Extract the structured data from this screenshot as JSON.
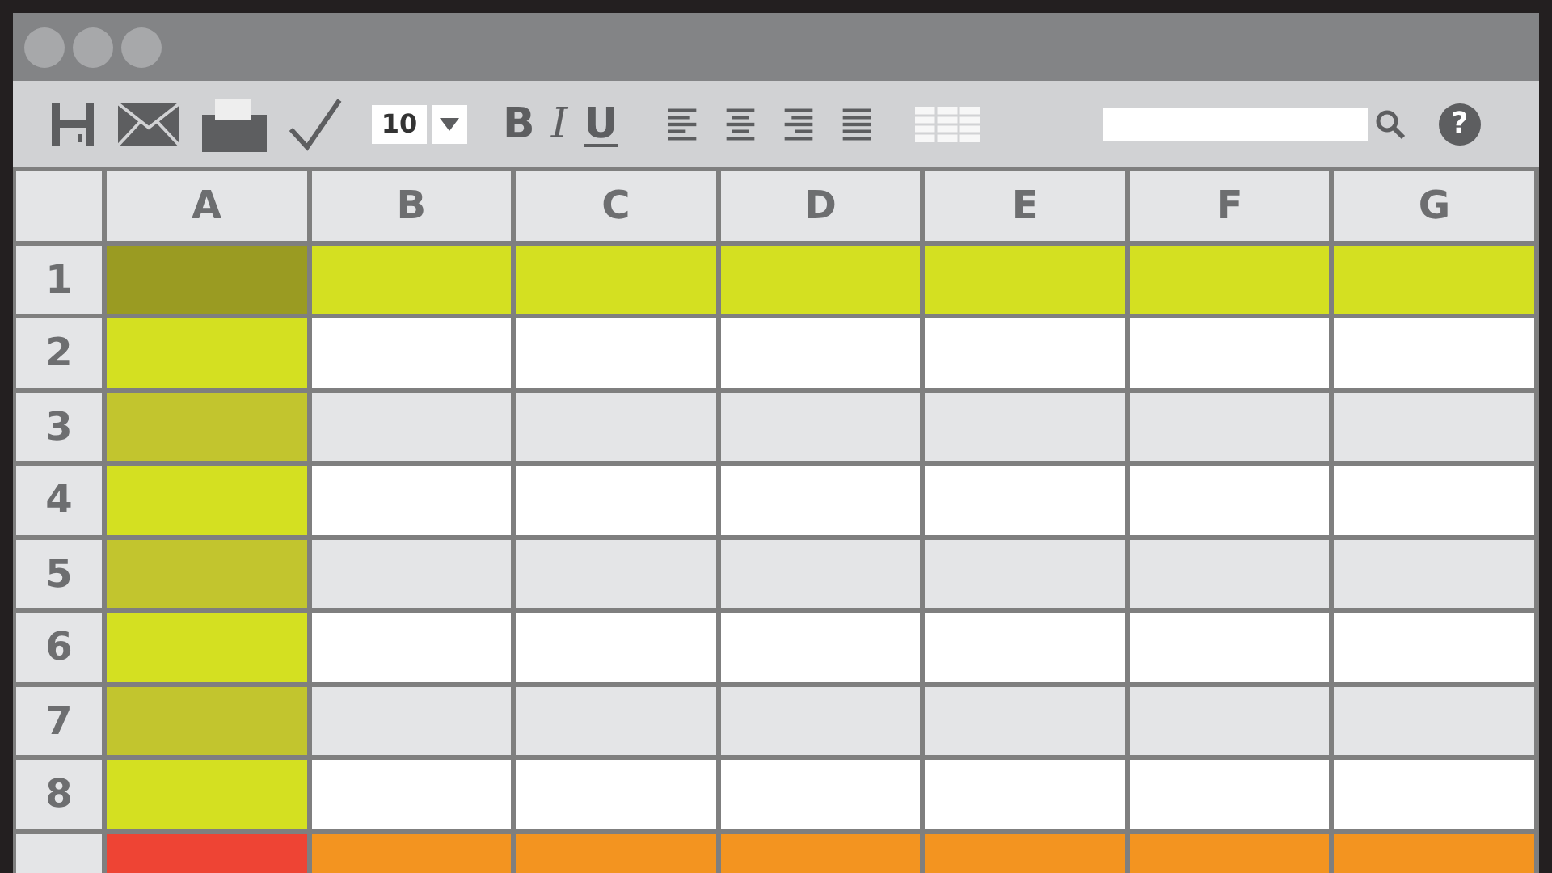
{
  "window": {
    "controls": [
      {
        "color": "#a7a8aa"
      },
      {
        "color": "#a7a8aa"
      },
      {
        "color": "#a7a8aa"
      }
    ]
  },
  "toolbar": {
    "font_size": "10",
    "format_buttons": [
      "B",
      "I",
      "U"
    ],
    "help": "?"
  },
  "sheet": {
    "columns": [
      "A",
      "B",
      "C",
      "D",
      "E",
      "F",
      "G"
    ],
    "rows": [
      {
        "label": "1",
        "cells": [
          {
            "color": "#9a9b22"
          },
          {
            "color": "#d4e021"
          },
          {
            "color": "#d4e021"
          },
          {
            "color": "#d4e021"
          },
          {
            "color": "#d4e021"
          },
          {
            "color": "#d4e021"
          },
          {
            "color": "#d4e021"
          }
        ]
      },
      {
        "label": "2",
        "cells": [
          {
            "color": "#d4e021"
          },
          {
            "color": "#ffffff"
          },
          {
            "color": "#ffffff"
          },
          {
            "color": "#ffffff"
          },
          {
            "color": "#ffffff"
          },
          {
            "color": "#ffffff"
          },
          {
            "color": "#ffffff"
          }
        ]
      },
      {
        "label": "3",
        "cells": [
          {
            "color": "#c2c52e"
          },
          {
            "color": "#e4e5e7"
          },
          {
            "color": "#e4e5e7"
          },
          {
            "color": "#e4e5e7"
          },
          {
            "color": "#e4e5e7"
          },
          {
            "color": "#e4e5e7"
          },
          {
            "color": "#e4e5e7"
          }
        ]
      },
      {
        "label": "4",
        "cells": [
          {
            "color": "#d4e021"
          },
          {
            "color": "#ffffff"
          },
          {
            "color": "#ffffff"
          },
          {
            "color": "#ffffff"
          },
          {
            "color": "#ffffff"
          },
          {
            "color": "#ffffff"
          },
          {
            "color": "#ffffff"
          }
        ]
      },
      {
        "label": "5",
        "cells": [
          {
            "color": "#c2c52e"
          },
          {
            "color": "#e4e5e7"
          },
          {
            "color": "#e4e5e7"
          },
          {
            "color": "#e4e5e7"
          },
          {
            "color": "#e4e5e7"
          },
          {
            "color": "#e4e5e7"
          },
          {
            "color": "#e4e5e7"
          }
        ]
      },
      {
        "label": "6",
        "cells": [
          {
            "color": "#d4e021"
          },
          {
            "color": "#ffffff"
          },
          {
            "color": "#ffffff"
          },
          {
            "color": "#ffffff"
          },
          {
            "color": "#ffffff"
          },
          {
            "color": "#ffffff"
          },
          {
            "color": "#ffffff"
          }
        ]
      },
      {
        "label": "7",
        "cells": [
          {
            "color": "#c2c52e"
          },
          {
            "color": "#e4e5e7"
          },
          {
            "color": "#e4e5e7"
          },
          {
            "color": "#e4e5e7"
          },
          {
            "color": "#e4e5e7"
          },
          {
            "color": "#e4e5e7"
          },
          {
            "color": "#e4e5e7"
          }
        ]
      },
      {
        "label": "8",
        "cells": [
          {
            "color": "#d4e021"
          },
          {
            "color": "#ffffff"
          },
          {
            "color": "#ffffff"
          },
          {
            "color": "#ffffff"
          },
          {
            "color": "#ffffff"
          },
          {
            "color": "#ffffff"
          },
          {
            "color": "#ffffff"
          }
        ]
      },
      {
        "cells": [
          {
            "color": "#ee4434"
          },
          {
            "color": "#f39420"
          },
          {
            "color": "#f39420"
          },
          {
            "color": "#f39420"
          },
          {
            "color": "#f39420"
          },
          {
            "color": "#f39420"
          },
          {
            "color": "#f39420"
          }
        ]
      }
    ]
  }
}
